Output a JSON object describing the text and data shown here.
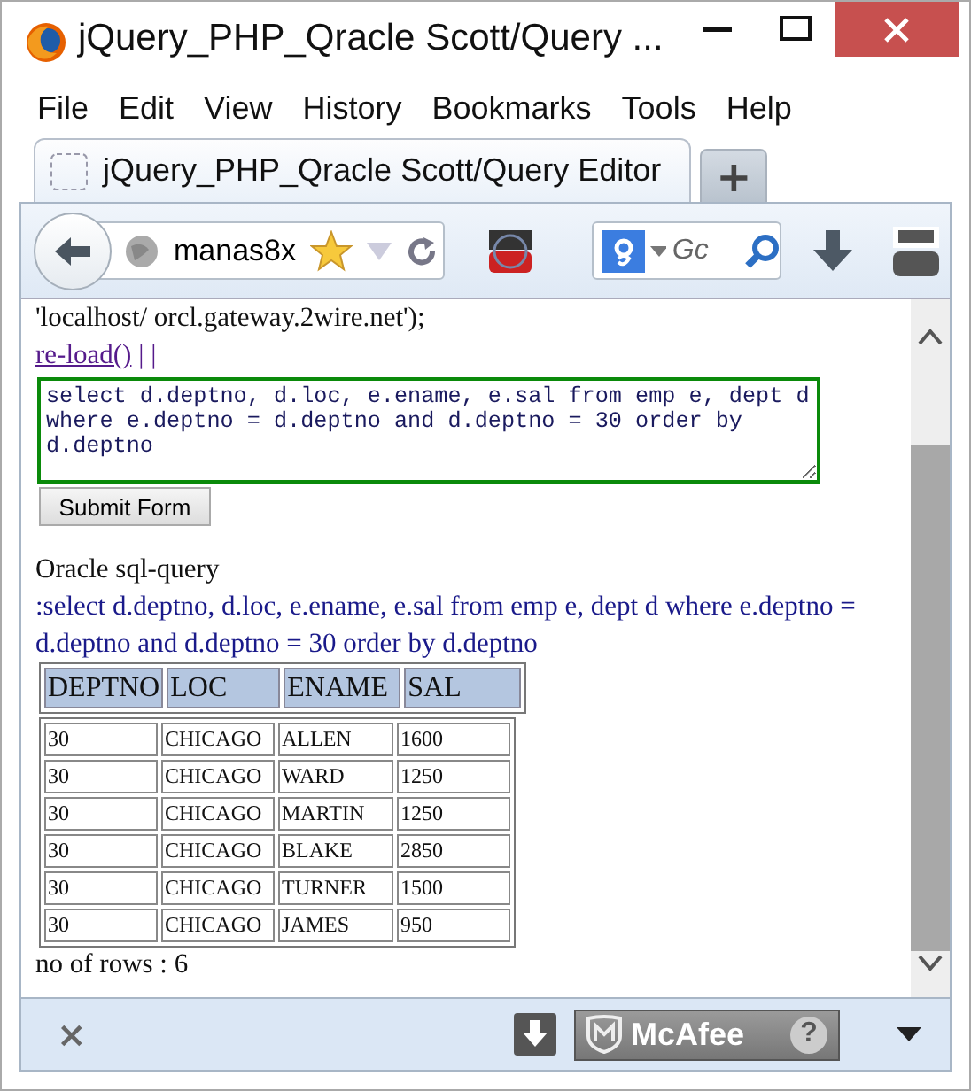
{
  "window": {
    "title": "jQuery_PHP_Qracle Scott/Query ..."
  },
  "menu": [
    {
      "label": "File"
    },
    {
      "label": "Edit"
    },
    {
      "label": "View"
    },
    {
      "label": "History"
    },
    {
      "label": "Bookmarks"
    },
    {
      "label": "Tools"
    },
    {
      "label": "Help"
    }
  ],
  "tabs": [
    {
      "label": "jQuery_PHP_Qracle Scott/Query Editor",
      "selected": true
    }
  ],
  "new_tab": "+",
  "toolbar": {
    "url": "manas8x",
    "search_placeholder": "Gc",
    "bookmarked": true
  },
  "page": {
    "connection": "'localhost/ orcl.gateway.2wire.net');",
    "reload_link": "re-load()",
    "separator": "| |",
    "query_input": "select d.deptno, d.loc, e.ename, e.sal from emp e, dept d where e.deptno = d.deptno and d.deptno = 30 order by d.deptno",
    "submit_button": "Submit Form",
    "result_heading": "Oracle sql-query",
    "query_echo": ":select d.deptno, d.loc, e.ename, e.sal from emp e, dept d where e.deptno = d.deptno and d.deptno = 30 order by d.deptno",
    "table": {
      "columns": [
        "DEPTNO",
        "LOC",
        "ENAME",
        "SAL"
      ],
      "rows": [
        [
          "30",
          "CHICAGO",
          "ALLEN",
          "1600"
        ],
        [
          "30",
          "CHICAGO",
          "WARD",
          "1250"
        ],
        [
          "30",
          "CHICAGO",
          "MARTIN",
          "1250"
        ],
        [
          "30",
          "CHICAGO",
          "BLAKE",
          "2850"
        ],
        [
          "30",
          "CHICAGO",
          "TURNER",
          "1500"
        ],
        [
          "30",
          "CHICAGO",
          "JAMES",
          "950"
        ]
      ]
    },
    "row_count": "no of rows : 6"
  },
  "addon_bar": {
    "close": "×",
    "security_button": "McAfee",
    "help": "?"
  }
}
